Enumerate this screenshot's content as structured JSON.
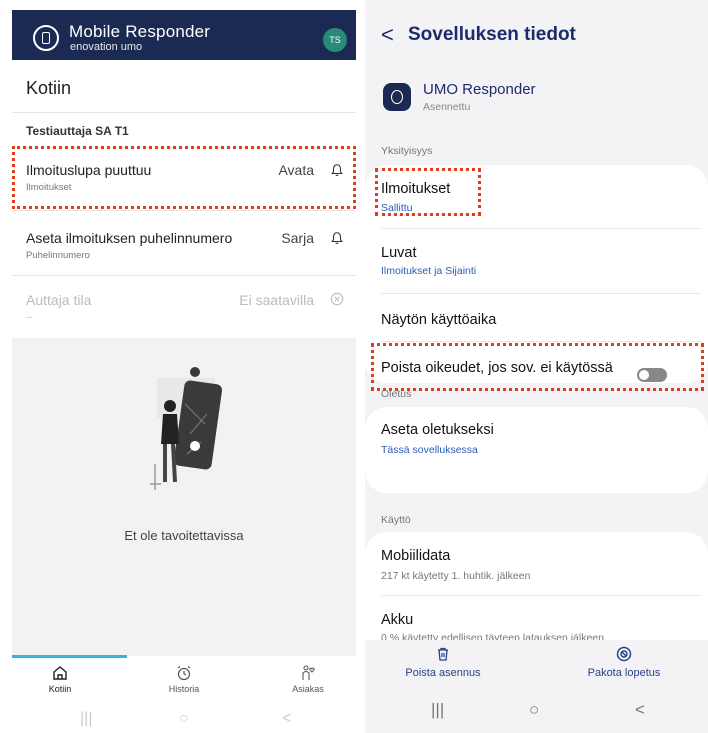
{
  "left": {
    "app_title": "Mobile Responder",
    "app_subtitle": "enovation umo",
    "avatar": "TS",
    "page_title": "Kotiin",
    "user_name": "Testiauttaja SA T1",
    "rows": [
      {
        "label": "Ilmoituslupa puuttuu",
        "sub": "Ilmoitukset",
        "action": "Avata",
        "icon": "bell-icon"
      },
      {
        "label": "Aseta ilmoituksen puhelinnumero",
        "sub": "Puhelinnumero",
        "action": "Sarja",
        "icon": "bell-icon"
      },
      {
        "label": "Auttaja tila",
        "sub": "--",
        "action": "Ei saatavilla",
        "icon": "close-circle-icon",
        "disabled": true
      }
    ],
    "empty_message": "Et ole tavoitettavissa",
    "nav": [
      {
        "label": "Kotiin",
        "icon": "home-icon",
        "active": true
      },
      {
        "label": "Historia",
        "icon": "alarm-clock-icon"
      },
      {
        "label": "Asiakas",
        "icon": "person-heart-icon"
      }
    ],
    "system_keys": [
      "|||",
      "○",
      "<"
    ]
  },
  "right": {
    "title": "Sovelluksen tiedot",
    "back": "<",
    "app_name": "UMO Responder",
    "app_status": "Asennettu",
    "sections": {
      "privacy": "Yksityisyys",
      "default": "Oletus",
      "usage": "Käyttö"
    },
    "items": {
      "notifications": {
        "title": "Ilmoitukset",
        "sub": "Sallittu"
      },
      "permissions": {
        "title": "Luvat",
        "sub": "Ilmoitukset ja Sijainti"
      },
      "screen_time": {
        "title": "Näytön käyttöaika"
      },
      "remove_perms": {
        "title": "Poista oikeudet, jos sov. ei käytössä",
        "toggle": false
      },
      "set_default": {
        "title": "Aseta oletukseksi",
        "sub": "Tässä sovelluksessa"
      },
      "mobile_data": {
        "title": "Mobiilidata",
        "sub": "217 kt käytetty 1. huhtik. jälkeen"
      },
      "battery": {
        "title": "Akku",
        "sub": "0 % käytetty edellisen täyteen latauksen jälkeen"
      }
    },
    "buttons": {
      "uninstall": "Poista asennus",
      "force_stop": "Pakota lopetus"
    },
    "system_keys": [
      "|||",
      "○",
      "<"
    ]
  },
  "colors": {
    "header_bg": "#1a2a52",
    "accent_blue": "#3ab1e6",
    "link_blue": "#2a5db8",
    "highlight_red": "#e23c1b",
    "avatar_bg": "#2a8a7a"
  }
}
